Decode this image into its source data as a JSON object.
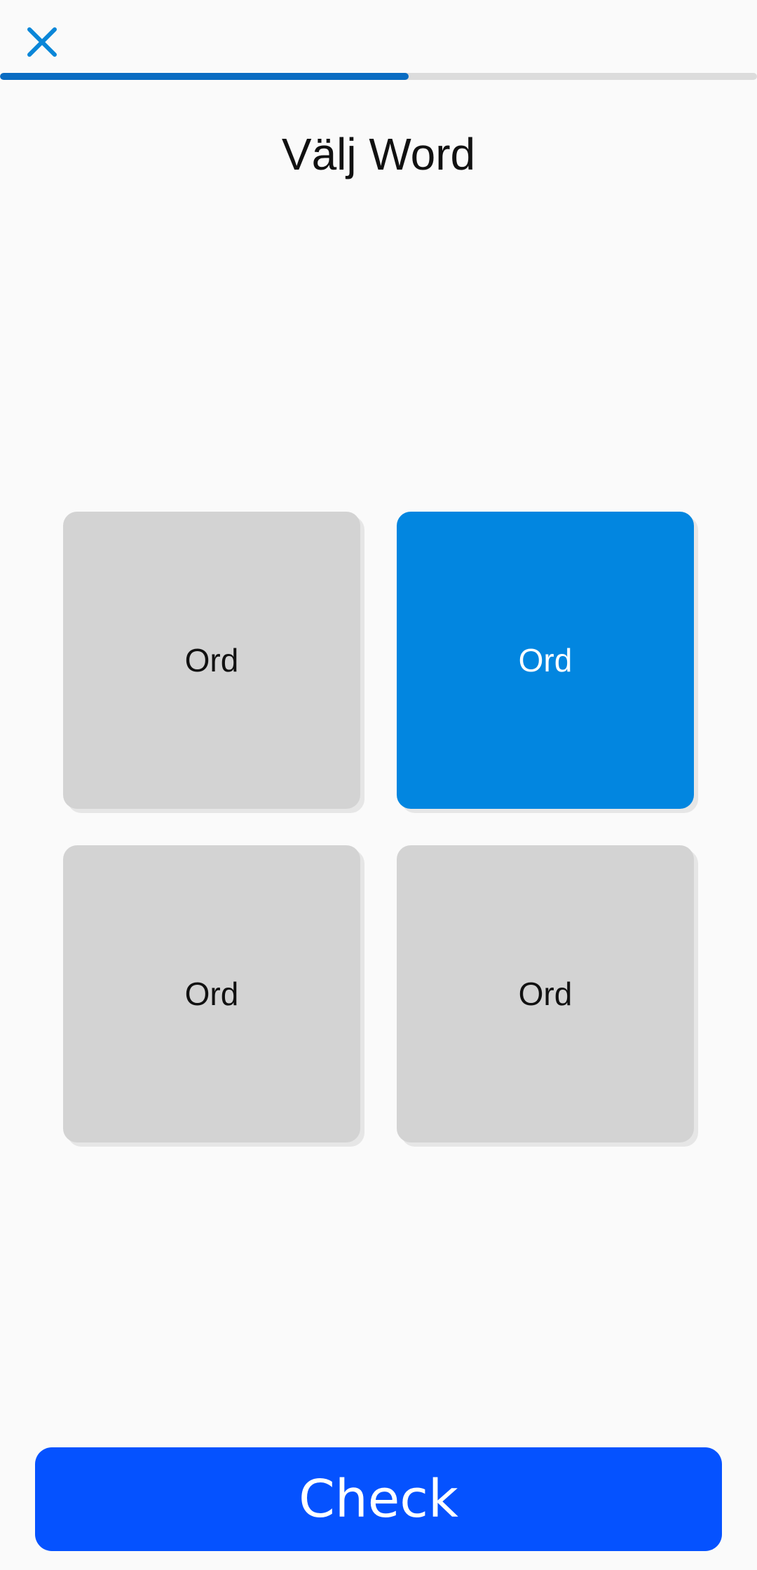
{
  "header": {
    "close_icon": "close-icon",
    "progress_fraction": 0.54
  },
  "title": "Välj Word",
  "options": [
    {
      "label": "Ord",
      "selected": false
    },
    {
      "label": "Ord",
      "selected": true
    },
    {
      "label": "Ord",
      "selected": false
    },
    {
      "label": "Ord",
      "selected": false
    }
  ],
  "colors": {
    "accent": "#0286e0",
    "progress": "#0a6cc2",
    "check_button": "#0552ff",
    "tile": "#d3d3d3"
  },
  "footer": {
    "check_label": "Check"
  }
}
